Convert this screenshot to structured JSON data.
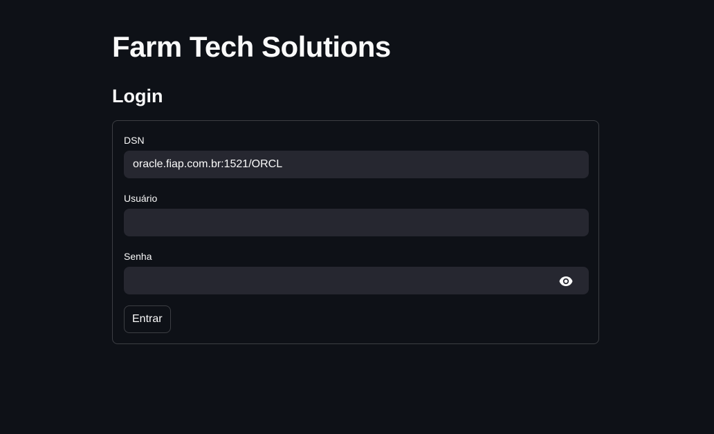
{
  "app": {
    "title": "Farm Tech Solutions"
  },
  "login": {
    "heading": "Login",
    "dsn": {
      "label": "DSN",
      "value": "oracle.fiap.com.br:1521/ORCL"
    },
    "user": {
      "label": "Usuário",
      "value": ""
    },
    "password": {
      "label": "Senha",
      "value": "",
      "toggle_icon": "eye-icon"
    },
    "submit_label": "Entrar"
  },
  "colors": {
    "background": "#0e1117",
    "input_background": "#262730",
    "text": "#fafafa",
    "border": "rgba(250,250,250,0.2)"
  }
}
